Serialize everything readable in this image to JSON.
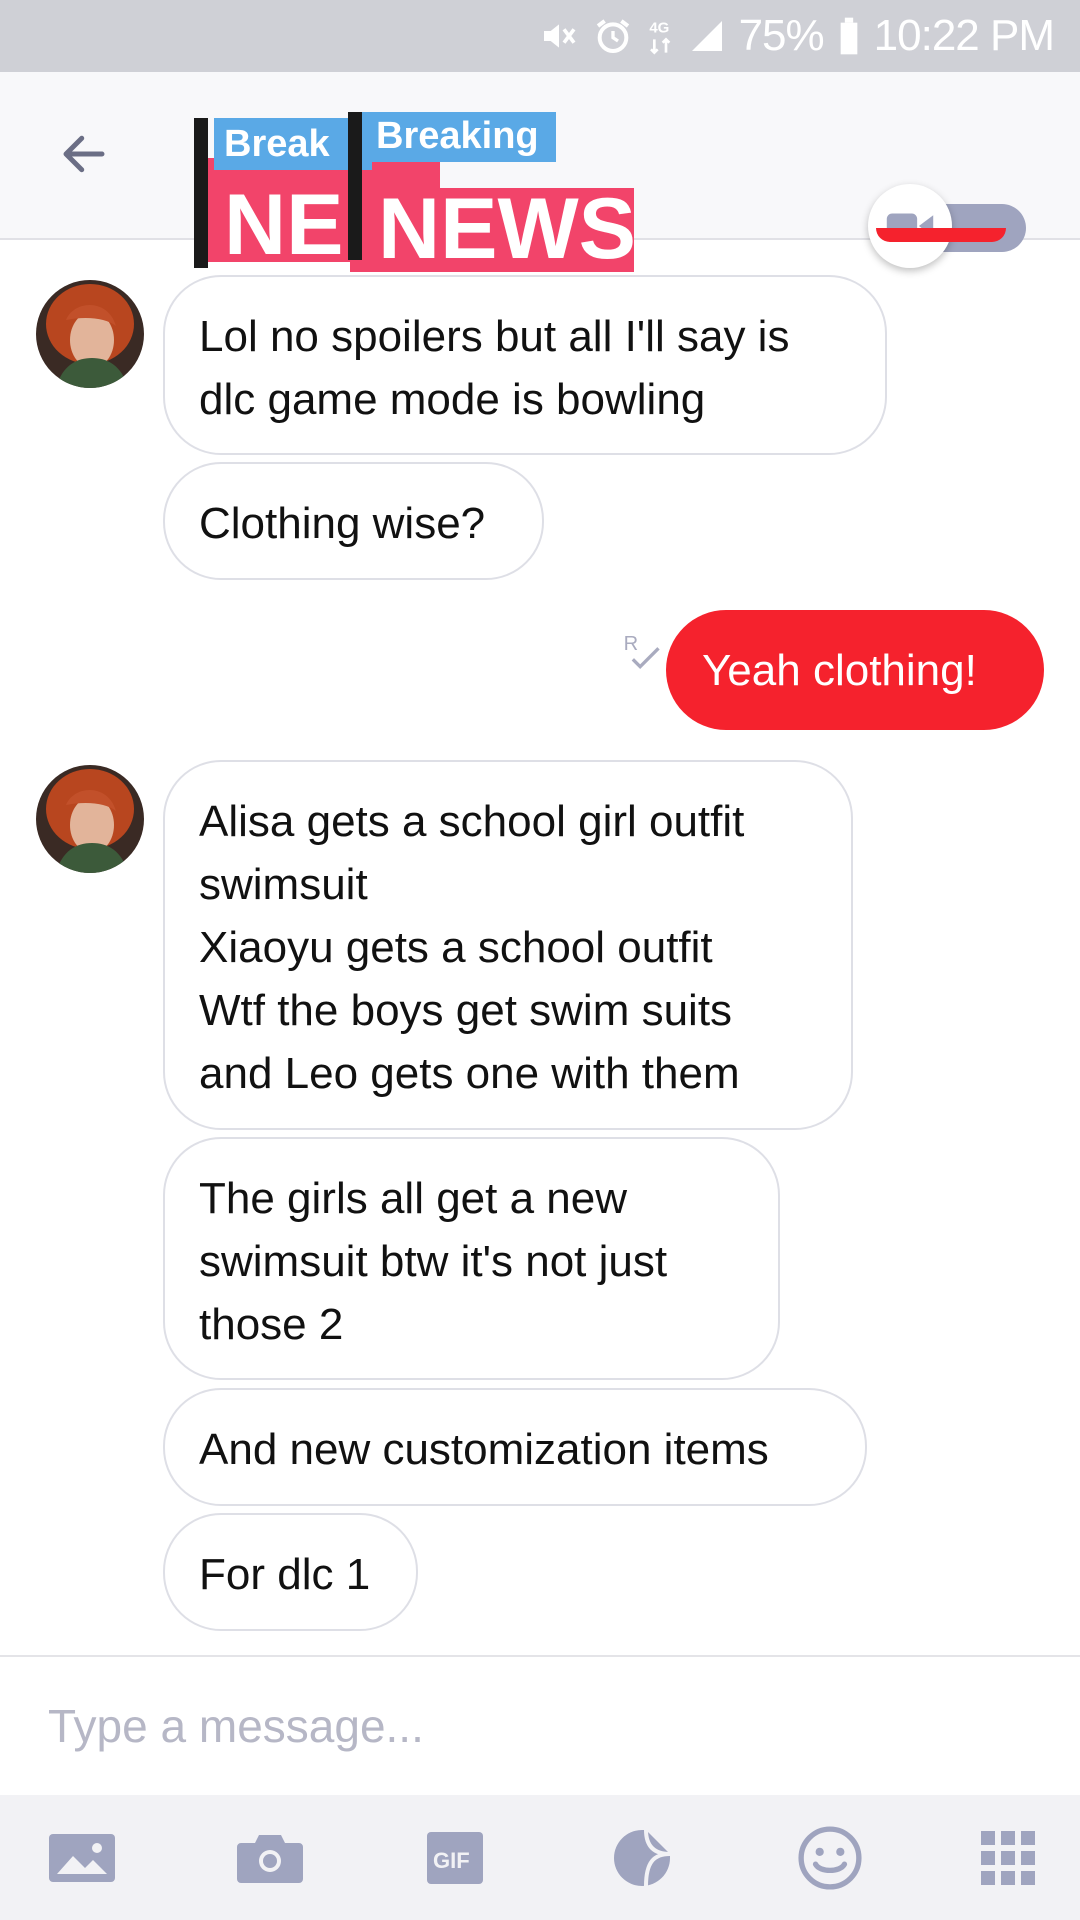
{
  "status_bar": {
    "battery_text": "75%",
    "time": "10:22 PM",
    "icons": [
      "mute-icon",
      "alarm-icon",
      "data-4g-icon",
      "signal-icon",
      "battery-icon"
    ]
  },
  "header": {
    "logo_text_small_1": "Break",
    "logo_text_small_2": "Breaking",
    "logo_text_big_1": "NE",
    "logo_text_big_2": "NEWS",
    "icons": [
      "back-arrow-icon",
      "video-camera-icon"
    ]
  },
  "messages": [
    {
      "sender": "them",
      "text": "Lol no spoilers but all I'll say is\ndlc game mode is bowling"
    },
    {
      "sender": "them",
      "text": "Clothing wise?"
    },
    {
      "sender": "me",
      "text": "Yeah clothing!",
      "receipt": "R"
    },
    {
      "sender": "them",
      "text": "Alisa gets a school girl outfit\nswimsuit\nXiaoyu gets a school outfit\nWtf the boys get swim suits\nand Leo gets one with them"
    },
    {
      "sender": "them",
      "text": "The girls all get a new\nswimsuit btw it's not just\nthose 2"
    },
    {
      "sender": "them",
      "text": "And new customization items"
    },
    {
      "sender": "them",
      "text": "For dlc 1"
    }
  ],
  "composer": {
    "placeholder": "Type a message..."
  },
  "toolbar": {
    "gif_label": "GIF",
    "icons": [
      "gallery-icon",
      "camera-icon",
      "gif-icon",
      "sticker-icon",
      "emoji-icon",
      "apps-grid-icon"
    ]
  },
  "colors": {
    "accent": "#f5222d",
    "icon_gray": "#9fa4bf",
    "status_bar": "#cfd0d6"
  }
}
